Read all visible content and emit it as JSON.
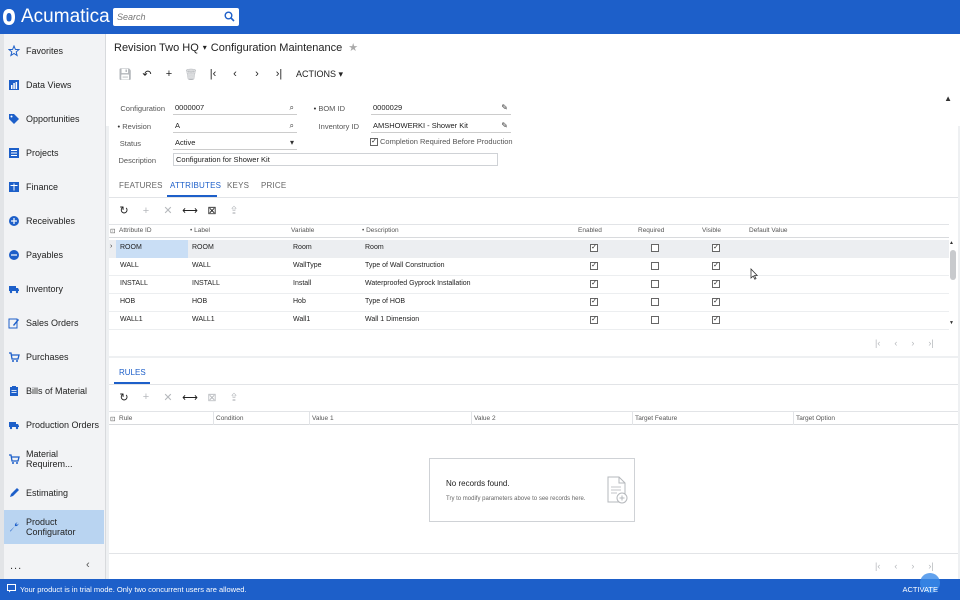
{
  "app": {
    "brand": "Acumatica",
    "search_placeholder": "Search"
  },
  "sidebar": {
    "items": [
      {
        "label": "Favorites",
        "icon": "star-icon"
      },
      {
        "label": "Data Views",
        "icon": "bar-chart-icon"
      },
      {
        "label": "Opportunities",
        "icon": "tag-icon"
      },
      {
        "label": "Projects",
        "icon": "list-icon"
      },
      {
        "label": "Finance",
        "icon": "scale-icon"
      },
      {
        "label": "Receivables",
        "icon": "plus-circle-icon"
      },
      {
        "label": "Payables",
        "icon": "minus-circle-icon"
      },
      {
        "label": "Inventory",
        "icon": "truck-icon"
      },
      {
        "label": "Sales Orders",
        "icon": "pencil-icon"
      },
      {
        "label": "Purchases",
        "icon": "cart-icon"
      },
      {
        "label": "Bills of Material",
        "icon": "clipboard-icon"
      },
      {
        "label": "Production Orders",
        "icon": "truck-icon"
      },
      {
        "label": "Material Requirem...",
        "icon": "cart-icon"
      },
      {
        "label": "Estimating",
        "icon": "pen-icon"
      },
      {
        "label": "Product Configurator",
        "icon": "wrench-icon"
      }
    ],
    "active_index": 14,
    "more": "...",
    "collapse": "‹"
  },
  "header": {
    "company": "Revision Two HQ",
    "page_title": "Configuration Maintenance"
  },
  "toolbar": {
    "actions_label": "ACTIONS"
  },
  "form": {
    "configuration_label": "Configuration",
    "configuration_value": "0000007",
    "revision_label": "Revision",
    "revision_value": "A",
    "status_label": "Status",
    "status_value": "Active",
    "description_label": "Description",
    "description_value": "Configuration for Shower Kit",
    "bom_id_label": "BOM ID",
    "bom_id_value": "0000029",
    "inventory_id_label": "Inventory ID",
    "inventory_id_value": "AMSHOWERKI - Shower Kit",
    "completion_label": "Completion Required Before Production",
    "completion_checked": true
  },
  "tabs": [
    "FEATURES",
    "ATTRIBUTES",
    "KEYS",
    "PRICE"
  ],
  "active_tab": "ATTRIBUTES",
  "attributes_grid": {
    "columns": [
      "Attribute ID",
      "Label",
      "Variable",
      "Description",
      "Enabled",
      "Required",
      "Visible",
      "Default Value"
    ],
    "rows": [
      {
        "attribute_id": "ROOM",
        "label": "ROOM",
        "variable": "Room",
        "description": "Room",
        "enabled": true,
        "required": false,
        "visible": true,
        "default_value": ""
      },
      {
        "attribute_id": "WALL",
        "label": "WALL",
        "variable": "WallType",
        "description": "Type of Wall Construction",
        "enabled": true,
        "required": false,
        "visible": true,
        "default_value": ""
      },
      {
        "attribute_id": "INSTALL",
        "label": "INSTALL",
        "variable": "Install",
        "description": "Waterproofed Gyprock Installation",
        "enabled": true,
        "required": false,
        "visible": true,
        "default_value": ""
      },
      {
        "attribute_id": "HOB",
        "label": "HOB",
        "variable": "Hob",
        "description": "Type of HOB",
        "enabled": true,
        "required": false,
        "visible": true,
        "default_value": ""
      },
      {
        "attribute_id": "WALL1",
        "label": "WALL1",
        "variable": "Wall1",
        "description": "Wall 1 Dimension",
        "enabled": true,
        "required": false,
        "visible": true,
        "default_value": ""
      }
    ]
  },
  "rules": {
    "tab_label": "RULES",
    "columns": [
      "Rule",
      "Condition",
      "Value 1",
      "Value 2",
      "Target Feature",
      "Target Option"
    ],
    "empty_title": "No records found.",
    "empty_subtitle": "Try to modify parameters above to see records here."
  },
  "status_bar": {
    "message": "Your product is in trial mode. Only two concurrent users are allowed.",
    "activate": "ACTIVATE"
  },
  "colors": {
    "brand_blue": "#1d5fc9",
    "selected_nav": "#b9d4f1",
    "accent_link": "#1d5fc9"
  }
}
